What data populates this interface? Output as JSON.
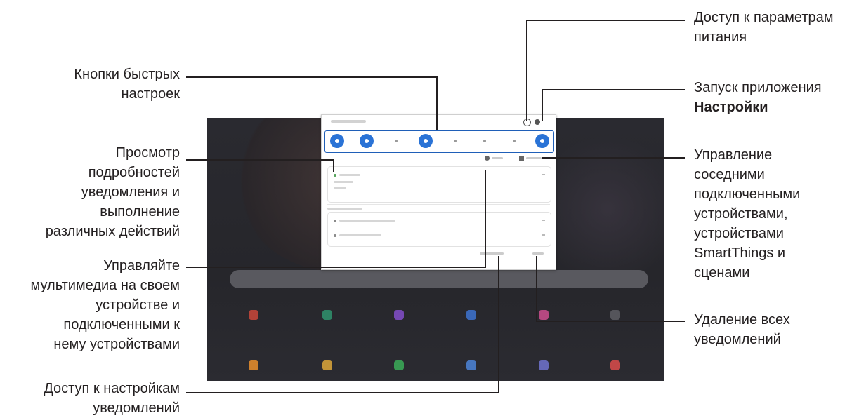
{
  "labels": {
    "quick_buttons": [
      "Кнопки быстрых",
      "настроек"
    ],
    "notif_details": [
      "Просмотр",
      "подробностей",
      "уведомления и",
      "выполнение",
      "различных действий"
    ],
    "media": [
      "Управляйте",
      "мультимедиа на своем",
      "устройстве и",
      "подключенными к",
      "нему устройствами"
    ],
    "notif_settings": [
      "Доступ к настройкам",
      "уведомлений"
    ],
    "power": [
      "Доступ к параметрам",
      "питания"
    ],
    "settings_app": {
      "line1": "Запуск приложения",
      "line2": "Настройки"
    },
    "devices": [
      "Управление",
      "соседними",
      "подключенными",
      "устройствами,",
      "устройствами",
      "SmartThings и",
      "сценами"
    ],
    "clear_all": [
      "Удаление всех",
      "уведомлений"
    ]
  },
  "icons": {
    "quick_settings": [
      "wifi-icon",
      "sound-icon",
      "bluetooth-icon",
      "auto-rotate-icon",
      "airplane-icon",
      "flashlight-icon",
      "mobile-data-icon",
      "sync-icon"
    ],
    "panel": [
      "power-icon",
      "gear-icon",
      "media-icon",
      "devices-icon"
    ]
  },
  "colors": {
    "accent": "#2a73d6",
    "tablet_bg": "#1f1f24",
    "text": "#231f20"
  }
}
